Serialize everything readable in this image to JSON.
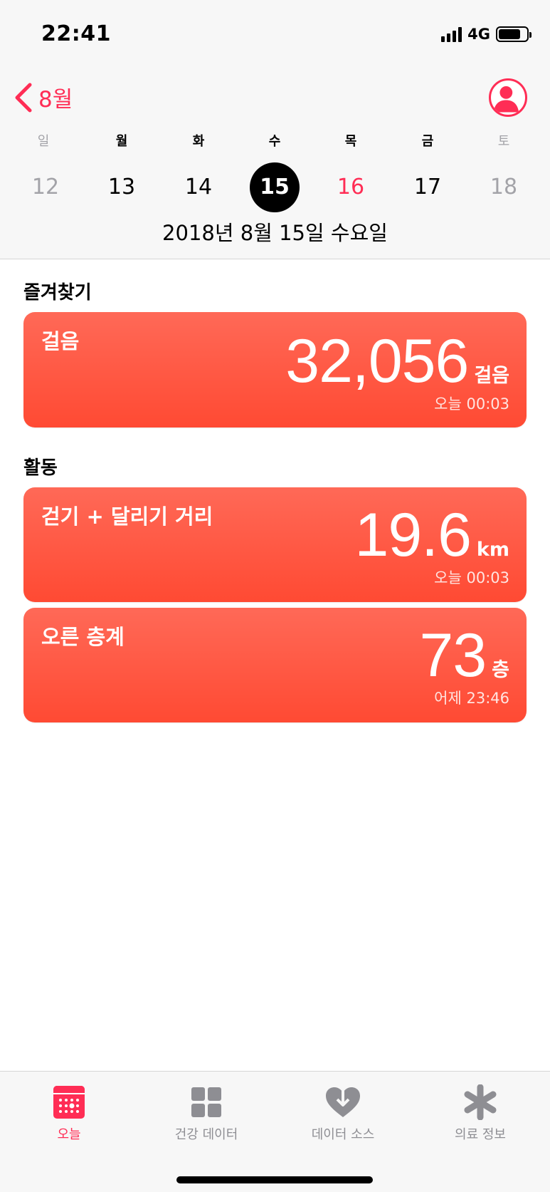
{
  "status_bar": {
    "time": "22:41",
    "network": "4G"
  },
  "nav": {
    "back_label": "8월"
  },
  "week": {
    "days": [
      {
        "weekday": "일",
        "date": "12",
        "state": "weekend"
      },
      {
        "weekday": "월",
        "date": "13",
        "state": "normal"
      },
      {
        "weekday": "화",
        "date": "14",
        "state": "normal"
      },
      {
        "weekday": "수",
        "date": "15",
        "state": "selected"
      },
      {
        "weekday": "목",
        "date": "16",
        "state": "today"
      },
      {
        "weekday": "금",
        "date": "17",
        "state": "normal"
      },
      {
        "weekday": "토",
        "date": "18",
        "state": "weekend"
      }
    ],
    "full_date": "2018년 8월 15일 수요일"
  },
  "favorites": {
    "title": "즐겨찾기",
    "cards": [
      {
        "name": "걸음",
        "value": "32,056",
        "unit": "걸음",
        "time": "오늘 00:03"
      }
    ]
  },
  "activity": {
    "title": "활동",
    "cards": [
      {
        "name": "걷기 + 달리기 거리",
        "value": "19.6",
        "unit": "km",
        "time": "오늘 00:03"
      },
      {
        "name": "오른 층계",
        "value": "73",
        "unit": "층",
        "time": "어제 23:46"
      }
    ]
  },
  "tabbar": {
    "tabs": [
      {
        "label": "오늘",
        "icon": "calendar-today-icon",
        "active": true
      },
      {
        "label": "건강 데이터",
        "icon": "grid-icon",
        "active": false
      },
      {
        "label": "데이터 소스",
        "icon": "heart-download-icon",
        "active": false
      },
      {
        "label": "의료 정보",
        "icon": "asterisk-icon",
        "active": false
      }
    ]
  },
  "colors": {
    "accent": "#ff2d55",
    "card": "#ff5a44"
  }
}
